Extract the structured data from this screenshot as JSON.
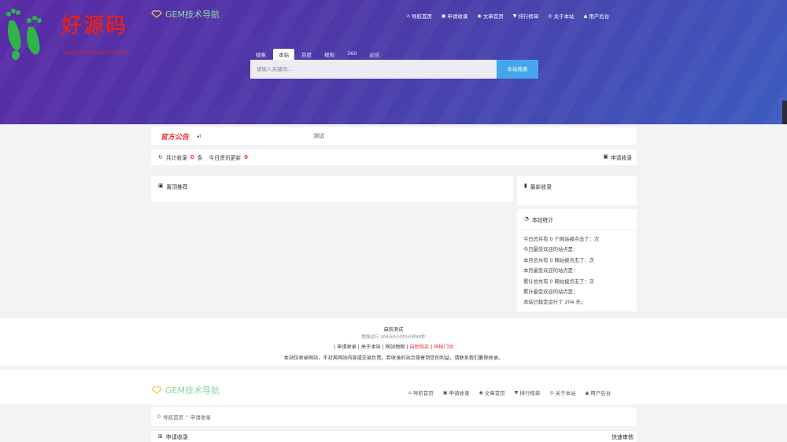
{
  "watermark": {
    "title": "好源码",
    "url": "www.haoyuanma.com"
  },
  "brand": {
    "name": "GEM技术导航"
  },
  "nav": [
    {
      "icon": "home-icon",
      "glyph": "⌂",
      "label": "导航首页"
    },
    {
      "icon": "inbox-icon",
      "glyph": "▣",
      "label": "申请收录"
    },
    {
      "icon": "article-icon",
      "glyph": "◉",
      "label": "文章首页"
    },
    {
      "icon": "rank-icon",
      "glyph": "▼",
      "label": "排行榜单"
    },
    {
      "icon": "info-icon",
      "glyph": "◎",
      "label": "关于本站"
    },
    {
      "icon": "user-icon",
      "glyph": "▲",
      "label": "用户后台"
    }
  ],
  "search": {
    "tabs": [
      "搜索",
      "本站",
      "百度",
      "搜狗",
      "360",
      "必应"
    ],
    "active_tab": "本站",
    "placeholder": "请输入关键词...",
    "button": "本站搜索"
  },
  "notice": {
    "title": "官方公告",
    "text": "测试"
  },
  "stats": {
    "total_label": "共计收录",
    "total_value": "0",
    "total_unit": "条",
    "today_label": "今日资讯更新",
    "today_value": "0",
    "apply": "申请收录"
  },
  "pinned": {
    "title": "置顶推荐"
  },
  "latest": {
    "title": "最新收录"
  },
  "sitestats": {
    "title": "本站统计",
    "lines": [
      "今日总共有 0 个网站被点击了：次",
      "今日最受欢迎的站点是：",
      "本月总共有 0 网站被点击了：次",
      "本月最受欢迎的站点是：",
      "累计总共有 0 网站被点击了：次",
      "累计最受欢迎的站点是：",
      "本站已稳定运行了 204 天。"
    ]
  },
  "footer": {
    "line1": "启航测试",
    "line2": "勉强运行 204天6小时0分钟49秒",
    "links": [
      "申请收录",
      "关于本站",
      "网站地图"
    ],
    "red_links": [
      "自助购买",
      "神秘门动"
    ],
    "disclaimer": "本站仅收录网站，不对其网站内容或交易负责。若收录的站点侵害到您的利益，请联系我们删除收录。"
  },
  "breadcrumb": {
    "home": "导航首页",
    "sep": "›",
    "current": "申请收录"
  },
  "apply_section": {
    "title": "申请收录",
    "right": "快速审核"
  }
}
